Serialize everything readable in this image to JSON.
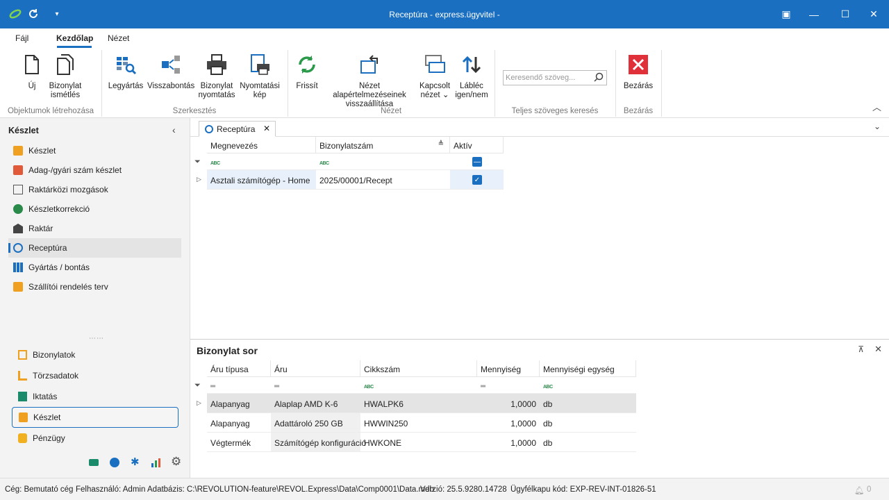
{
  "window": {
    "title": "Receptúra - express.ügyvitel -",
    "controls": {
      "snap": "▣",
      "minimize": "—",
      "maximize": "☐",
      "close": "✕"
    }
  },
  "menu": {
    "items": [
      "Fájl",
      "Kezdőlap",
      "Nézet"
    ]
  },
  "ribbon": {
    "buttons": {
      "new": "Új",
      "repeat": [
        "Bizonylat",
        "ismétlés"
      ],
      "production": "Legyártás",
      "disassembly": "Visszabontás",
      "print_doc": [
        "Bizonylat",
        "nyomtatás"
      ],
      "print_view": [
        "Nyomtatási",
        "kép"
      ],
      "refresh": "Frissít",
      "reset_view": [
        "Nézet alapértelmezéseinek",
        "visszaállítása"
      ],
      "linked_view": [
        "Kapcsolt",
        "nézet"
      ],
      "footer_toggle": [
        "Lábléc",
        "igen/nem"
      ],
      "close": "Bezárás"
    },
    "groups": {
      "create": "Objektumok létrehozása",
      "edit": "Szerkesztés",
      "view": "Nézet",
      "search": "Teljes szöveges keresés",
      "close": "Bezárás"
    },
    "search_placeholder": "Keresendő szöveg..."
  },
  "sidebar": {
    "title": "Készlet",
    "items": [
      {
        "label": "Készlet",
        "color": "#f0a020"
      },
      {
        "label": "Adag-/gyári szám készlet",
        "color": "#e05a3a"
      },
      {
        "label": "Raktárközi mozgások",
        "color": "#555555"
      },
      {
        "label": "Készletkorrekció",
        "color": "#2a8a4a"
      },
      {
        "label": "Raktár",
        "color": "#444444"
      },
      {
        "label": "Receptúra",
        "color": "#1a6fc1"
      },
      {
        "label": "Gyártás / bontás",
        "color": "#1a6fc1"
      },
      {
        "label": "Szállítói rendelés terv",
        "color": "#f0a020"
      }
    ],
    "modules": [
      {
        "label": "Bizonylatok",
        "color": "#f0a020"
      },
      {
        "label": "Törzsadatok",
        "color": "#f0a020"
      },
      {
        "label": "Iktatás",
        "color": "#1a8a6a"
      },
      {
        "label": "Készlet",
        "color": "#f0a020"
      },
      {
        "label": "Pénzügy",
        "color": "#f0b020"
      }
    ]
  },
  "main": {
    "tab": "Receptúra",
    "columns": [
      "Megnevezés",
      "Bizonylatszám",
      "Aktív"
    ],
    "rows": [
      {
        "name": "Asztali számítógép - Home",
        "number": "2025/00001/Recept",
        "active": true
      }
    ]
  },
  "detail": {
    "title": "Bizonylat sor",
    "columns": [
      "Áru típusa",
      "Áru",
      "Cikkszám",
      "Mennyiség",
      "Mennyiségi egység"
    ],
    "rows": [
      {
        "type": "Alapanyag",
        "item": "Alaplap AMD K-6",
        "sku": "HWALPK6",
        "qty": "1,0000",
        "unit": "db"
      },
      {
        "type": "Alapanyag",
        "item": "Adattároló 250 GB",
        "sku": "HWWIN250",
        "qty": "1,0000",
        "unit": "db"
      },
      {
        "type": "Végtermék",
        "item": "Számítógép konfiguráció",
        "sku": "HWKONE",
        "qty": "1,0000",
        "unit": "db"
      }
    ]
  },
  "status": {
    "company": "Cég: Bemutató cég",
    "user": "Felhasználó: Admin",
    "database": "Adatbázis: C:\\REVOLUTION-feature\\REVOL.Express\\Data\\Comp0001\\Data.mdb",
    "version": "Verzió: 25.5.9280.14728",
    "client_code": "Ügyfélkapu kód: EXP-REV-INT-01826-51",
    "notifications": "0"
  }
}
